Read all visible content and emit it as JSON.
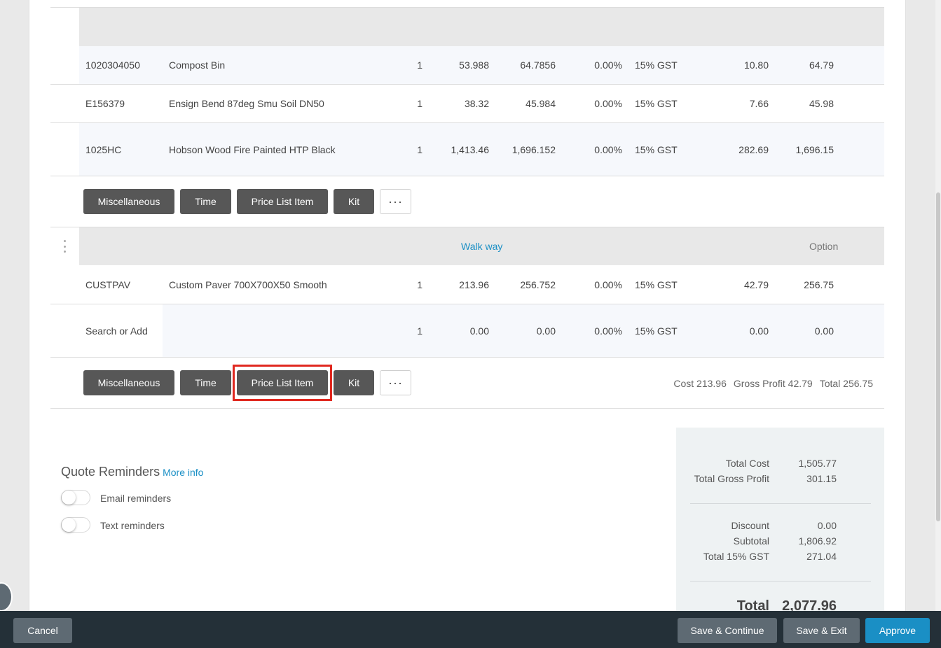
{
  "section1": {
    "rows": [
      {
        "code": "1020304050",
        "desc": "Compost Bin",
        "qty": "1",
        "cost": "53.988",
        "price": "64.7856",
        "disc": "0.00%",
        "tax": "15% GST",
        "gp": "10.80",
        "total": "64.79"
      },
      {
        "code": "E156379",
        "desc": "Ensign Bend 87deg Smu Soil DN50",
        "qty": "1",
        "cost": "38.32",
        "price": "45.984",
        "disc": "0.00%",
        "tax": "15% GST",
        "gp": "7.66",
        "total": "45.98"
      },
      {
        "code": "1025HC",
        "desc": "Hobson Wood Fire Painted HTP Black",
        "qty": "1",
        "cost": "1,413.46",
        "price": "1,696.152",
        "disc": "0.00%",
        "tax": "15% GST",
        "gp": "282.69",
        "total": "1,696.15"
      }
    ]
  },
  "buttons": {
    "miscellaneous": "Miscellaneous",
    "time": "Time",
    "price_list_item": "Price List Item",
    "kit": "Kit",
    "more": "···"
  },
  "section2": {
    "heading": "Walk way",
    "option": "Option",
    "rows": [
      {
        "code": "CUSTPAV",
        "desc": "Custom Paver 700X700X50 Smooth",
        "qty": "1",
        "cost": "213.96",
        "price": "256.752",
        "disc": "0.00%",
        "tax": "15% GST",
        "gp": "42.79",
        "total": "256.75"
      }
    ],
    "search_row": {
      "placeholder": "Search or Add",
      "qty": "1",
      "cost": "0.00",
      "price": "0.00",
      "disc": "0.00%",
      "tax": "15% GST",
      "gp": "0.00",
      "total": "0.00"
    },
    "totals": {
      "cost": "Cost 213.96",
      "gross_profit": "Gross Profit 42.79",
      "total": "Total 256.75"
    }
  },
  "quote_reminders": {
    "title": "Quote Reminders",
    "more_info": "More info",
    "email": "Email reminders",
    "text": "Text reminders"
  },
  "summary": {
    "total_cost_label": "Total Cost",
    "total_cost": "1,505.77",
    "total_gp_label": "Total Gross Profit",
    "total_gp": "301.15",
    "discount_label": "Discount",
    "discount": "0.00",
    "subtotal_label": "Subtotal",
    "subtotal": "1,806.92",
    "gst_label": "Total 15% GST",
    "gst": "271.04",
    "total_label": "Total",
    "total": "2,077.96"
  },
  "footer": {
    "cancel": "Cancel",
    "save_continue": "Save & Continue",
    "save_exit": "Save & Exit",
    "approve": "Approve"
  },
  "colors": {
    "accent": "#1a8fc5",
    "dark_button": "#575757",
    "footer": "#243038",
    "highlight": "#e0281f"
  }
}
